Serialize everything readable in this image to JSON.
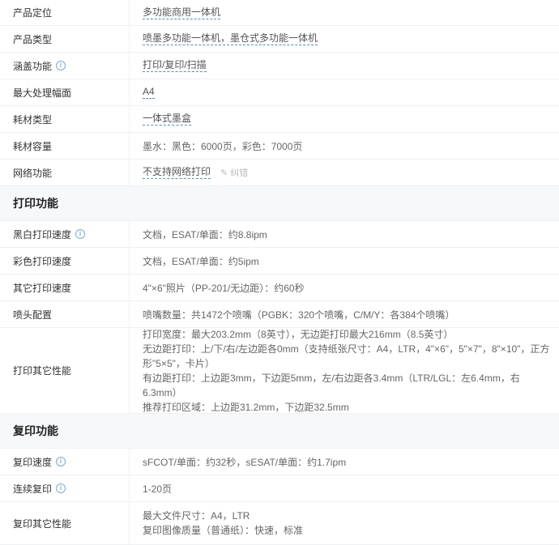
{
  "basic": {
    "positioning_label": "产品定位",
    "positioning_value": "多功能商用一体机",
    "type_label": "产品类型",
    "type_value": "喷墨多功能一体机，墨仓式多功能一体机",
    "functions_label": "涵盖功能",
    "functions_value": "打印/复印/扫描",
    "max_size_label": "最大处理幅面",
    "max_size_value": "A4",
    "consumable_type_label": "耗材类型",
    "consumable_type_value": "一体式墨盒",
    "consumable_capacity_label": "耗材容量",
    "consumable_capacity_value": "墨水：黑色：6000页，彩色：7000页",
    "network_label": "网络功能",
    "network_value": "不支持网络打印",
    "correction_label": "纠错"
  },
  "print": {
    "section_title": "打印功能",
    "bw_speed_label": "黑白打印速度",
    "bw_speed_value": "文档，ESAT/单面：约8.8ipm",
    "color_speed_label": "彩色打印速度",
    "color_speed_value": "文档，ESAT/单面：约5ipm",
    "other_speed_label": "其它打印速度",
    "other_speed_value": "4\"×6\"照片（PP-201/无边距）：约60秒",
    "nozzle_label": "喷头配置",
    "nozzle_value": "喷嘴数量：共1472个喷嘴（PGBK：320个喷嘴，C/M/Y：各384个喷嘴）",
    "other_perf_label": "打印其它性能",
    "other_perf_lines": [
      "打印宽度：最大203.2mm（8英寸），无边距打印最大216mm（8.5英寸）",
      "无边距打印：上/下/右/左边距各0mm（支持纸张尺寸：A4，LTR，4\"×6\"，5\"×7\"，8\"×10\"，正方",
      "形\"5×5\"，卡片）",
      "有边距打印：上边距3mm，下边距5mm，左/右边距各3.4mm（LTR/LGL：左6.4mm，右6.3mm）",
      "推荐打印区域：上边距31.2mm，下边距32.5mm"
    ]
  },
  "copy": {
    "section_title": "复印功能",
    "speed_label": "复印速度",
    "speed_value": "sFCOT/单面：约32秒，sESAT/单面：约1.7ipm",
    "continuous_label": "连续复印",
    "continuous_value": "1-20页",
    "other_perf_label": "复印其它性能",
    "other_perf_lines": [
      "最大文件尺寸：A4，LTR",
      "复印图像质量（普通纸）：快速，标准"
    ]
  },
  "icons": {
    "info": "info-icon",
    "edit": "pencil-icon"
  },
  "colors": {
    "link_underline": "#4e8cdb",
    "section_bg": "#f7f8fa",
    "info_icon": "#7aa7e0"
  }
}
